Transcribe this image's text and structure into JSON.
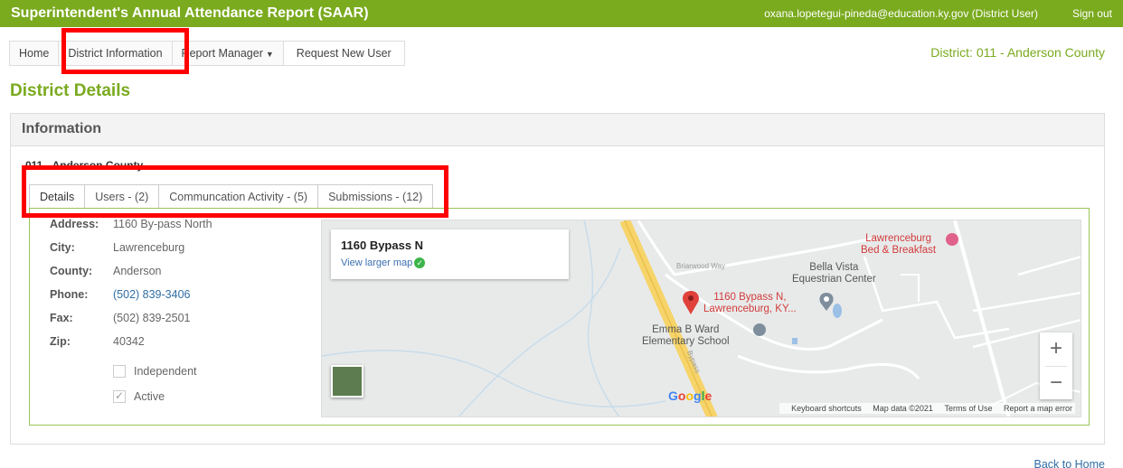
{
  "header": {
    "title": "Superintendent's Annual Attendance Report (SAAR)",
    "user": "oxana.lopetegui-pineda@education.ky.gov (District User)",
    "signout": "Sign out",
    "bg_color": "#7aaa1e"
  },
  "nav": {
    "items": [
      "Home",
      "District Information",
      "Report Manager",
      "Request New User"
    ],
    "district_label": "District: 011 - Anderson County"
  },
  "page_title": "District Details",
  "panel": {
    "heading": "Information",
    "district_name": "011 - Anderson County"
  },
  "tabs": [
    "Details",
    "Users - (2)",
    "Communcation Activity - (5)",
    "Submissions - (12)"
  ],
  "details": {
    "address_label": "Address:",
    "address": "1160 By-pass North",
    "city_label": "City:",
    "city": "Lawrenceburg",
    "county_label": "County:",
    "county": "Anderson",
    "phone_label": "Phone:",
    "phone": "(502) 839-3406",
    "fax_label": "Fax:",
    "fax": "(502) 839-2501",
    "zip_label": "Zip:",
    "zip": "40342",
    "independent_label": "Independent",
    "active_label": "Active"
  },
  "map": {
    "card_title": "1160 Bypass N",
    "view_larger": "View larger map",
    "pin_label_1": "1160 Bypass N,",
    "pin_label_2": "Lawrenceburg, KY...",
    "poi_1a": "Bella Vista",
    "poi_1b": "Equestrian Center",
    "poi_2a": "Emma B Ward",
    "poi_2b": "Elementary School",
    "poi_3a": "Lawrenceburg",
    "poi_3b": "Bed & Breakfast",
    "road_1": "Briarwood Way",
    "road_2": "Bypass",
    "google": "Google",
    "attrib_1": "Keyboard shortcuts",
    "attrib_2": "Map data ©2021",
    "attrib_3": "Terms of Use",
    "attrib_4": "Report a map error"
  },
  "back_home": "Back to Home"
}
